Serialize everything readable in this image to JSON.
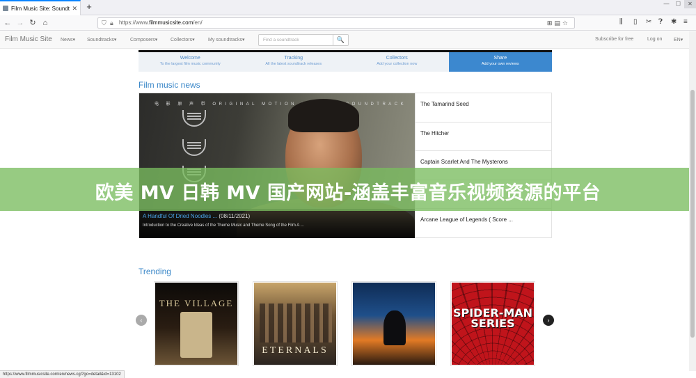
{
  "browser": {
    "tab_title": "Film Music Site: Soundtrack I",
    "tab_close": "✕",
    "new_tab": "+",
    "url_prefix": "https://www.",
    "url_domain": "filmmusicsite.com",
    "url_path": "/en/",
    "status_url": "https://www.filmmusicsite.com/en/news.cgi?go=detail&id=13102"
  },
  "site": {
    "brand": "Film Music Site",
    "menu": [
      "News",
      "Soundtracks",
      "Composers",
      "Collectors",
      "My soundtracks"
    ],
    "search_placeholder": "Find a soundtrack",
    "search_icon": "🔍",
    "right_links": [
      "Subscribe for free",
      "Log on",
      "EN"
    ]
  },
  "features": [
    {
      "title": "Welcome",
      "subtitle": "To the largest film music community"
    },
    {
      "title": "Tracking",
      "subtitle": "All the latest soundtrack releases"
    },
    {
      "title": "Collectors",
      "subtitle": "Add your collection now"
    },
    {
      "title": "Share",
      "subtitle": "Add your own reviews"
    }
  ],
  "news": {
    "heading": "Film music news",
    "hero_banner_text": "电 影 原 声 带   ORIGINAL MOTION PICTURE SOUNDTRACK",
    "featured_title": "A Handful Of Dried Noodles ...",
    "featured_date": "(08/11/2021)",
    "featured_desc": "Introduction to the Creative Ideas of the Theme Music and Theme Song of the Film A ...",
    "items": [
      "The Tamarind Seed",
      "The Hitcher",
      "Captain Scarlet And The Mysterons",
      "",
      "Arcane League of Legends ( Score ..."
    ]
  },
  "overlay_banner": "欧美 MV 日韩 MV 国产网站-涵盖丰富音乐视频资源的平台",
  "trending": {
    "heading": "Trending",
    "prev_icon": "‹",
    "next_icon": "›",
    "covers": [
      {
        "text": "THE VILLAGE"
      },
      {
        "text": "ETERNALS"
      },
      {
        "text": ""
      },
      {
        "text": "SPIDER-MAN SERIES"
      }
    ]
  },
  "colors": {
    "accent": "#3a87c8",
    "banner": "#7abc5f",
    "share_tab": "#3c88cf"
  }
}
